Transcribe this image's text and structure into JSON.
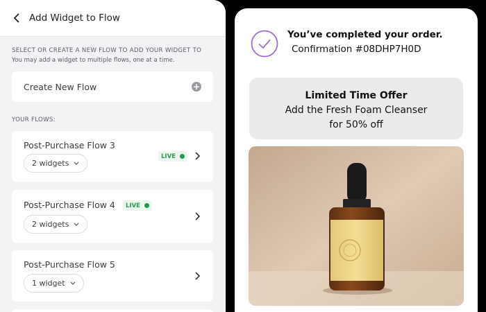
{
  "left": {
    "header": {
      "title": "Add Widget to Flow",
      "back_icon": "chevron-left-icon"
    },
    "section_title": "SELECT OR CREATE A NEW FLOW TO ADD YOUR WIDGET TO",
    "section_sub": "You may add a widget to multiple flows, one at a time.",
    "create_label": "Create New Flow",
    "create_icon": "plus-circle-icon",
    "flows_label": "YOUR FLOWS:",
    "flows": [
      {
        "name": "Post-Purchase Flow 3",
        "widgets": "2 widgets",
        "live": "LIVE"
      },
      {
        "name": "Post-Purchase Flow 4",
        "widgets": "2 widgets",
        "live": "LIVE"
      },
      {
        "name": "Post-Purchase Flow 5",
        "widgets": "1 widget",
        "live": ""
      }
    ]
  },
  "right": {
    "order_title": "You’ve completed your order.",
    "confirmation": "Confirmation #08DHP7H0D",
    "offer": {
      "title": "Limited Time Offer",
      "line1": "Add the Fresh Foam Cleanser",
      "line2": "for 50% off"
    }
  },
  "colors": {
    "accent_purple": "#9b6bd6",
    "live_green": "#1f9a4a",
    "panel_bg": "#f3f3f5",
    "offer_bg": "#ebebeb"
  }
}
